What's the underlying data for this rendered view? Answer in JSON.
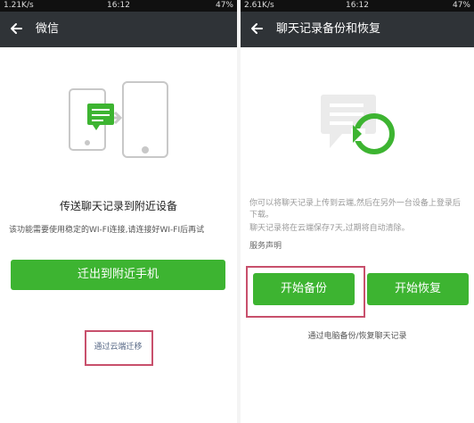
{
  "left": {
    "status": {
      "left": "1.21K/s",
      "time": "16:12",
      "right": "47%"
    },
    "title": "微信",
    "heading": "传送聊天记录到附近设备",
    "description": "该功能需要使用稳定的WI-FI连接,请连接好WI-FI后再试",
    "migrate_button": "迁出到附近手机",
    "cloud_link": "通过云端迁移",
    "colors": {
      "accent": "#3db431",
      "highlight": "#c8506c"
    }
  },
  "right": {
    "status": {
      "left": "2.61K/s",
      "time": "16:12",
      "right": "47%"
    },
    "title": "聊天记录备份和恢复",
    "description_1": "你可以将聊天记录上传到云端,然后在另外一台设备上登录后下载。",
    "description_2": "聊天记录将在云端保存7天,过期将自动清除。",
    "service_link": "服务声明",
    "backup_button": "开始备份",
    "restore_button": "开始恢复",
    "pc_link": "通过电脑备份/恢复聊天记录"
  }
}
